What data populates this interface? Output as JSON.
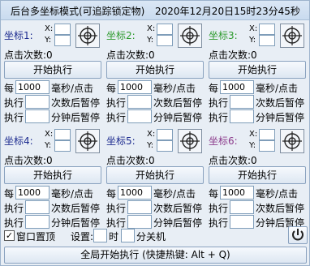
{
  "header": {
    "title": "后台多坐标模式(可追踪锁定物)",
    "datetime": "2020年12月20日15时23分45秒"
  },
  "labels": {
    "x": "X:",
    "y": "Y:",
    "click_count": "点击次数:",
    "start": "开始执行",
    "every": "每",
    "ms_per_click": "毫秒/点击",
    "execute": "执行",
    "pause_after_count": "次数后暂停",
    "pause_after_minutes": "分钟后暂停"
  },
  "coords": [
    {
      "label": "坐标1:",
      "click_count": "0",
      "interval": "1000",
      "color": "#1c2b8f"
    },
    {
      "label": "坐标2:",
      "click_count": "0",
      "interval": "1000",
      "color": "#2e9b2e"
    },
    {
      "label": "坐标3:",
      "click_count": "0",
      "interval": "1000",
      "color": "#2e9b2e"
    },
    {
      "label": "坐标4:",
      "click_count": "0",
      "interval": "1000",
      "color": "#1c2b8f"
    },
    {
      "label": "坐标5:",
      "click_count": "0",
      "interval": "1000",
      "color": "#1c2b8f"
    },
    {
      "label": "坐标6:",
      "click_count": "0",
      "interval": "1000",
      "color": "#8b3a8b"
    }
  ],
  "footer": {
    "window_top_label": "窗口置顶",
    "window_top_checked": true,
    "settings_label": "设置:",
    "hour_label": "时",
    "minute_label": "分关机",
    "global_start": "全局开始执行 (快捷热键: Alt + Q)"
  }
}
